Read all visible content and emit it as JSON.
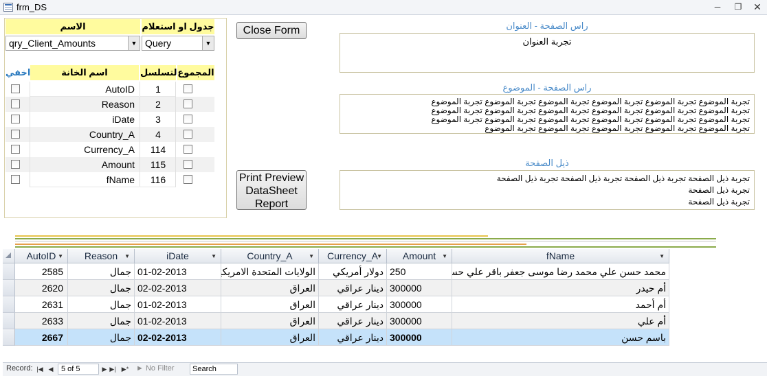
{
  "window": {
    "title": "frm_DS"
  },
  "left_panel": {
    "header_name": "الاسم",
    "header_type": "جدول او استعلام",
    "name_value": "qry_Client_Amounts",
    "type_value": "Query",
    "grid_headers": {
      "hide": "اخفي",
      "field_name": "اسم الخانة",
      "sequence": "التسلسل",
      "total": "المجموع"
    },
    "fields": [
      {
        "name": "AutoID",
        "seq": "1"
      },
      {
        "name": "Reason",
        "seq": "2"
      },
      {
        "name": "iDate",
        "seq": "3"
      },
      {
        "name": "Country_A",
        "seq": "4"
      },
      {
        "name": "Currency_A",
        "seq": "114"
      },
      {
        "name": "Amount",
        "seq": "115"
      },
      {
        "name": "fName",
        "seq": "116"
      }
    ]
  },
  "buttons": {
    "close_form": "Close Form",
    "print_line1": "Print Preview",
    "print_line2": "DataSheet",
    "print_line3": "Report"
  },
  "sections": {
    "header_title_label": "راس الصفحة - العنوان",
    "header_title_text": "تجربة العنوان",
    "header_subject_label": "راس الصفحة - الموضوع",
    "header_subject_lines": [
      "تجربة الموضوع تجربة الموضوع تجربة الموضوع تجربة الموضوع تجربة الموضوع تجربة الموضوع",
      "تجربة الموضوع تجربة الموضوع تجربة الموضوع تجربة الموضوع تجربة الموضوع تجربة الموضوع",
      "تجربة الموضوع تجربة الموضوع تجربة الموضوع تجربة الموضوع تجربة الموضوع تجربة الموضوع",
      "تجربة الموضوع تجربة الموضوع تجربة الموضوع تجربة الموضوع تجربة الموضوع"
    ],
    "footer_label": "ذيل الصفحة",
    "footer_lines": [
      "تجربة ذيل الصفحة تجربة ذيل الصفحة تجربة ذيل الصفحة تجربة ذيل الصفحة",
      "تجربة ذيل الصفحة",
      "تجربة ذيل الصفحة"
    ]
  },
  "datasheet": {
    "columns": [
      "AutoID",
      "Reason",
      "iDate",
      "Country_A",
      "Currency_A",
      "Amount",
      "fName"
    ],
    "rows": [
      {
        "AutoID": "2585",
        "Reason": "جمال",
        "iDate": "01-02-2013",
        "Country_A": "الولايات المتحدة الامريكية",
        "Currency_A": "دولار أمريكي",
        "Amount": "250",
        "fName": "محمد حسن علي محمد رضا موسى جعفر باقر علي حسين علي"
      },
      {
        "AutoID": "2620",
        "Reason": "جمال",
        "iDate": "02-02-2013",
        "Country_A": "العراق",
        "Currency_A": "دينار عراقي",
        "Amount": "300000",
        "fName": "أم حيدر"
      },
      {
        "AutoID": "2631",
        "Reason": "جمال",
        "iDate": "01-02-2013",
        "Country_A": "العراق",
        "Currency_A": "دينار عراقي",
        "Amount": "300000",
        "fName": "أم أحمد"
      },
      {
        "AutoID": "2633",
        "Reason": "جمال",
        "iDate": "01-02-2013",
        "Country_A": "العراق",
        "Currency_A": "دينار عراقي",
        "Amount": "300000",
        "fName": "أم علي"
      },
      {
        "AutoID": "2667",
        "Reason": "جمال",
        "iDate": "02-02-2013",
        "Country_A": "العراق",
        "Currency_A": "دينار عراقي",
        "Amount": "300000",
        "fName": "باسم حسن"
      }
    ]
  },
  "statusbar": {
    "record_label": "Record:",
    "record_value": "5 of 5",
    "filter_label": "No Filter",
    "search_placeholder": "Search"
  },
  "colors": {
    "header_yellow": "#fffb9e",
    "label_blue": "#4a8bc9",
    "selected_row": "#c5e2fa"
  }
}
